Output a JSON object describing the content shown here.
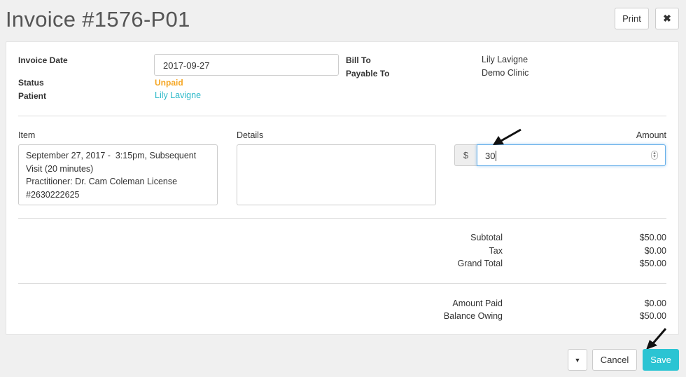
{
  "header": {
    "title": "Invoice #1576-P01",
    "print_label": "Print",
    "close_icon": "close-icon"
  },
  "info": {
    "invoice_date_label": "Invoice Date",
    "invoice_date_value": "2017-09-27",
    "status_label": "Status",
    "status_value": "Unpaid",
    "patient_label": "Patient",
    "patient_value": "Lily Lavigne",
    "bill_to_label": "Bill To",
    "bill_to_value": "Lily Lavigne",
    "payable_to_label": "Payable To",
    "payable_to_value": "Demo Clinic"
  },
  "line_item": {
    "item_label": "Item",
    "item_text": "September 27, 2017 -  3:15pm, Subsequent Visit (20 minutes)\nPractitioner: Dr. Cam Coleman License #2630222625",
    "details_label": "Details",
    "details_text": "",
    "amount_label": "Amount",
    "currency_symbol": "$",
    "amount_value": "30"
  },
  "totals": {
    "subtotal_label": "Subtotal",
    "subtotal_value": "$50.00",
    "tax_label": "Tax",
    "tax_value": "$0.00",
    "grand_total_label": "Grand Total",
    "grand_total_value": "$50.00",
    "amount_paid_label": "Amount Paid",
    "amount_paid_value": "$0.00",
    "balance_owing_label": "Balance Owing",
    "balance_owing_value": "$50.00"
  },
  "footer": {
    "dropdown_icon": "caret-down-icon",
    "cancel_label": "Cancel",
    "save_label": "Save"
  },
  "colors": {
    "accent": "#2ab8c8",
    "unpaid": "#f5a623",
    "save_button": "#2bc4d3"
  }
}
